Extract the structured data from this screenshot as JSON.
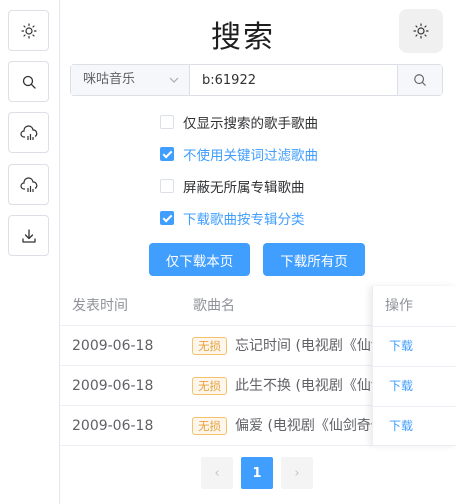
{
  "sidebar": {
    "buttons": [
      {
        "icon": "sun-icon"
      },
      {
        "icon": "search-icon"
      },
      {
        "icon": "cloud-chart-icon"
      },
      {
        "icon": "cloud-chart-icon"
      },
      {
        "icon": "download-icon"
      }
    ]
  },
  "header": {
    "title": "搜索",
    "theme_icon": "sun-icon"
  },
  "search": {
    "source": "咪咕音乐",
    "query": "b:61922",
    "button_icon": "search-icon"
  },
  "options": [
    {
      "label": "仅显示搜索的歌手歌曲",
      "checked": false
    },
    {
      "label": "不使用关键词过滤歌曲",
      "checked": true
    },
    {
      "label": "屏蔽无所属专辑歌曲",
      "checked": false
    },
    {
      "label": "下载歌曲按专辑分类",
      "checked": true
    }
  ],
  "actions": {
    "download_page": "仅下载本页",
    "download_all": "下载所有页"
  },
  "table": {
    "headers": {
      "date": "发表时间",
      "name": "歌曲名",
      "ops": "操作"
    },
    "rows": [
      {
        "date": "2009-06-18",
        "tag": "无损",
        "name": "忘记时间 (电视剧《仙剑奇侠传三》片头曲)",
        "op": "下载"
      },
      {
        "date": "2009-06-18",
        "tag": "无损",
        "name": "此生不换 (电视剧《仙剑奇侠传三》片尾曲)",
        "op": "下载"
      },
      {
        "date": "2009-06-18",
        "tag": "无损",
        "name": "偏爱 (电视剧《仙剑奇侠传三》插曲)",
        "op": "下载"
      }
    ]
  },
  "pagination": {
    "prev": "‹",
    "current": "1",
    "next": "›"
  },
  "colors": {
    "primary": "#409eff",
    "tag": "#e6a23c",
    "border": "#dcdfe6"
  }
}
